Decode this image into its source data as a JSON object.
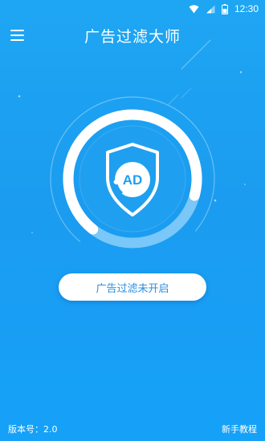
{
  "status_bar": {
    "time": "12:30",
    "icons": [
      "wifi-icon",
      "signal-icon",
      "battery-icon"
    ]
  },
  "app_bar": {
    "title": "广告过滤大师",
    "menu_icon": "hamburger-menu-icon"
  },
  "main": {
    "badge_text": "AD",
    "shield_icon": "shield-ad-icon",
    "toggle_label": "广告过滤未开启"
  },
  "footer": {
    "version_label": "版本号：",
    "version_value": "2.0",
    "tutorial_link": "新手教程"
  },
  "colors": {
    "background_top": "#1ea6f3",
    "background_bottom": "#15a1f8",
    "button_text": "#2b8fe0",
    "accent_white": "#ffffff"
  }
}
